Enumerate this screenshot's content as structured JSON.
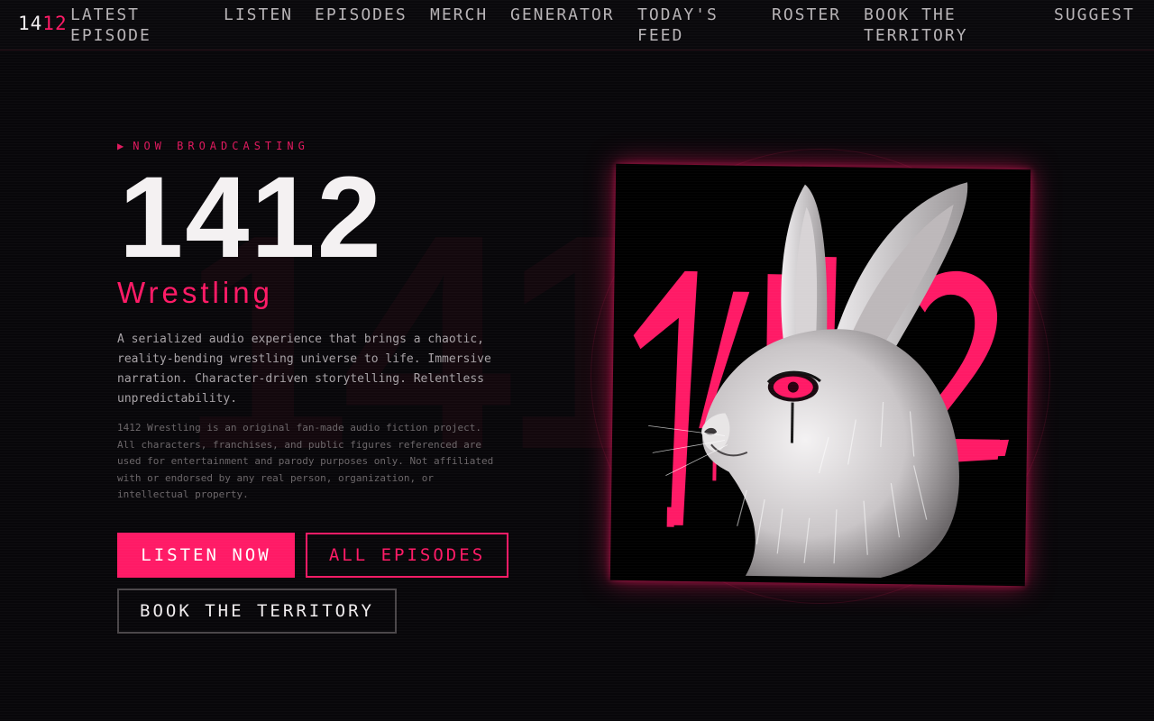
{
  "nav": {
    "logo_part1": "14",
    "logo_part2": "12",
    "items": [
      {
        "line1": "LATEST",
        "line2": "EPISODE"
      },
      {
        "line1": "LISTEN",
        "line2": ""
      },
      {
        "line1": "EPISODES",
        "line2": ""
      },
      {
        "line1": "MERCH",
        "line2": ""
      },
      {
        "line1": "GENERATOR",
        "line2": ""
      },
      {
        "line1": "TODAY'S",
        "line2": "FEED"
      },
      {
        "line1": "ROSTER",
        "line2": ""
      },
      {
        "line1": "BOOK THE",
        "line2": "TERRITORY"
      },
      {
        "line1": "SUGGEST",
        "line2": ""
      }
    ]
  },
  "hero": {
    "kicker_icon": "play-triangle-icon",
    "kicker": "NOW BROADCASTING",
    "title": "1412",
    "subtitle": "Wrestling",
    "description": "A serialized audio experience that brings a chaotic, reality-bending wrestling universe to life. Immersive narration. Character-driven storytelling. Relentless unpredictability.",
    "disclaimer": "1412 Wrestling is an original fan-made audio fiction project. All characters, franchises, and public figures referenced are used for entertainment and parody purposes only. Not affiliated with or endorsed by any real person, organization, or intellectual property."
  },
  "buttons": {
    "listen_now": "LISTEN NOW",
    "all_episodes": "ALL EPISODES",
    "book_territory": "BOOK THE TERRITORY"
  },
  "artwork": {
    "graffiti_text": "1412",
    "icon": "rabbit-artwork",
    "accent": "#ff1a66"
  },
  "colors": {
    "accent": "#ff1a66",
    "background": "#08070a"
  }
}
